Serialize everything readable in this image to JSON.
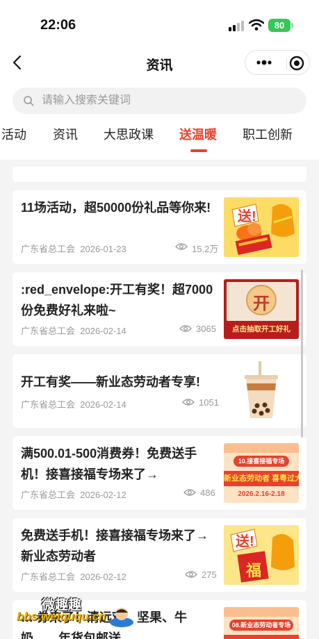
{
  "status_bar": {
    "time": "22:06",
    "battery": "80"
  },
  "nav": {
    "title": "资讯"
  },
  "search": {
    "placeholder": "请输入搜索关键词"
  },
  "tabs": [
    {
      "label": "活动"
    },
    {
      "label": "资讯"
    },
    {
      "label": "大思政课"
    },
    {
      "label": "送温暖",
      "active": true
    },
    {
      "label": "职工创新"
    }
  ],
  "articles": [
    {
      "title": "11场活动，超50000份礼品等你来!",
      "source": "广东省总工会",
      "date": "2026-01-23",
      "views": "15.2万",
      "thumb": "gift-red-envelope"
    },
    {
      "title": ":red_envelope:开工有奖！超7000份免费好礼来啦~",
      "source": "广东省总工会",
      "date": "2026-02-14",
      "views": "3065",
      "thumb_text": "开",
      "thumb_caption": "点击抽取开工好礼"
    },
    {
      "title": "开工有奖——新业态劳动者专享!",
      "source": "广东省总工会",
      "date": "2026-02-14",
      "views": "1051",
      "thumb": "bubble-tea"
    },
    {
      "title": "满500.01-500消费券！免费送手机！接喜接福专场来了→",
      "source": "广东省总工会",
      "date": "2026-02-12",
      "views": "486",
      "thumb_text": "10.接喜接福专场",
      "thumb_caption": "新业态劳动者 喜粤过大年",
      "thumb_date": "2026.2.16-2.18"
    },
    {
      "title": "免费送手机！接喜接福专场来了→新业态劳动者",
      "source": "广东省总工会",
      "date": "2026-02-12",
      "views": "275",
      "thumb_text": "福"
    },
    {
      "title": "… 券来了！清远鸡、坚果、牛奶……年货包邮送…",
      "thumb_text": "08.新业态劳动者专场"
    }
  ],
  "watermark": {
    "title": "微趣趣",
    "url": "bbs.weiququ.cn"
  },
  "colors": {
    "accent": "#e8412c",
    "battery": "#34c759",
    "muted": "#999999"
  }
}
